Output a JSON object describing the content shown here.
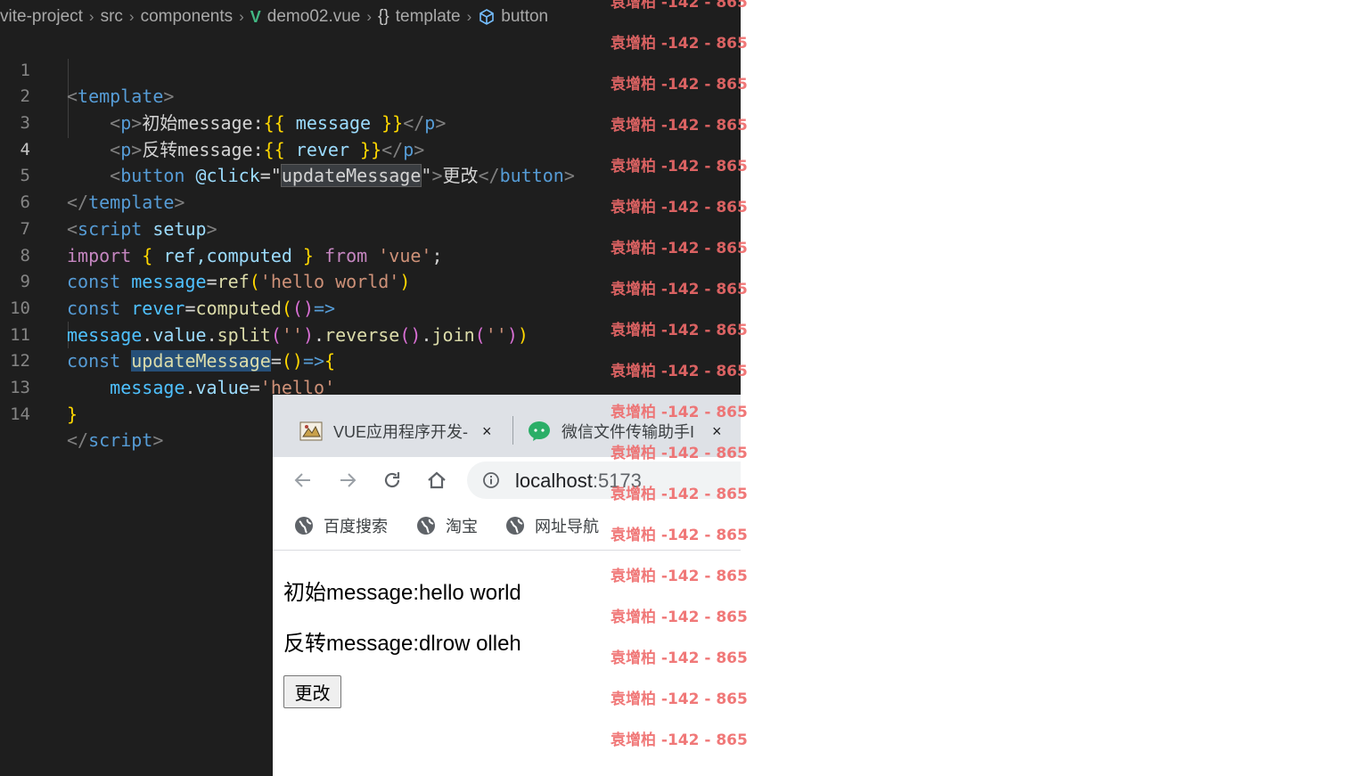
{
  "breadcrumb": {
    "items": [
      "vite-project",
      "src",
      "components",
      "demo02.vue",
      "template",
      "button"
    ]
  },
  "editor": {
    "line_numbers": [
      "1",
      "2",
      "3",
      "4",
      "5",
      "6",
      "7",
      "8",
      "9",
      "10",
      "11",
      "12",
      "13",
      "14"
    ],
    "active_line": "4",
    "code": {
      "l1_tag": "template",
      "l2_tag": "p",
      "l2_text": "初始message:",
      "l2_mustache_open": "{{",
      "l2_expr": " message ",
      "l2_mustache_close": "}}",
      "l3_tag": "p",
      "l3_text": "反转message:",
      "l3_mustache_open": "{{",
      "l3_expr": " rever ",
      "l3_mustache_close": "}}",
      "l4_tag": "button",
      "l4_attr": "@click",
      "l4_value": "updateMessage",
      "l4_text": "更改",
      "l5_tag": "template",
      "l6_tag": "script",
      "l6_attr": "setup",
      "l7_kw_import": "import",
      "l7_names": " ref,computed ",
      "l7_kw_from": "from",
      "l7_module": "'vue'",
      "l8_kw": "const",
      "l8_var": "message",
      "l8_fn": "ref",
      "l8_str": "'hello world'",
      "l9_kw": "const",
      "l9_var": "rever",
      "l9_fn": "computed",
      "l10_obj": "message",
      "l10_prop": "value",
      "l10_fn_split": "split",
      "l10_str1": "''",
      "l10_fn_reverse": "reverse",
      "l10_fn_join": "join",
      "l10_str2": "''",
      "l11_kw": "const",
      "l11_var": "updateMessage",
      "l12_obj": "message",
      "l12_prop": "value",
      "l12_str": "'hello'",
      "l14_tag": "script"
    }
  },
  "browser": {
    "tabs": [
      {
        "title": "VUE应用程序开发-",
        "close": "×"
      },
      {
        "title": "微信文件传输助手I",
        "close": "×"
      }
    ],
    "address": {
      "host": "localhost",
      "port": ":5173"
    },
    "bookmarks": [
      "百度搜索",
      "淘宝",
      "网址导航"
    ],
    "page": {
      "line1": "初始message:hello world",
      "line2": "反转message:dlrow olleh",
      "button_label": "更改"
    }
  },
  "watermark": {
    "text": "袁增柏 -142 - 865"
  }
}
